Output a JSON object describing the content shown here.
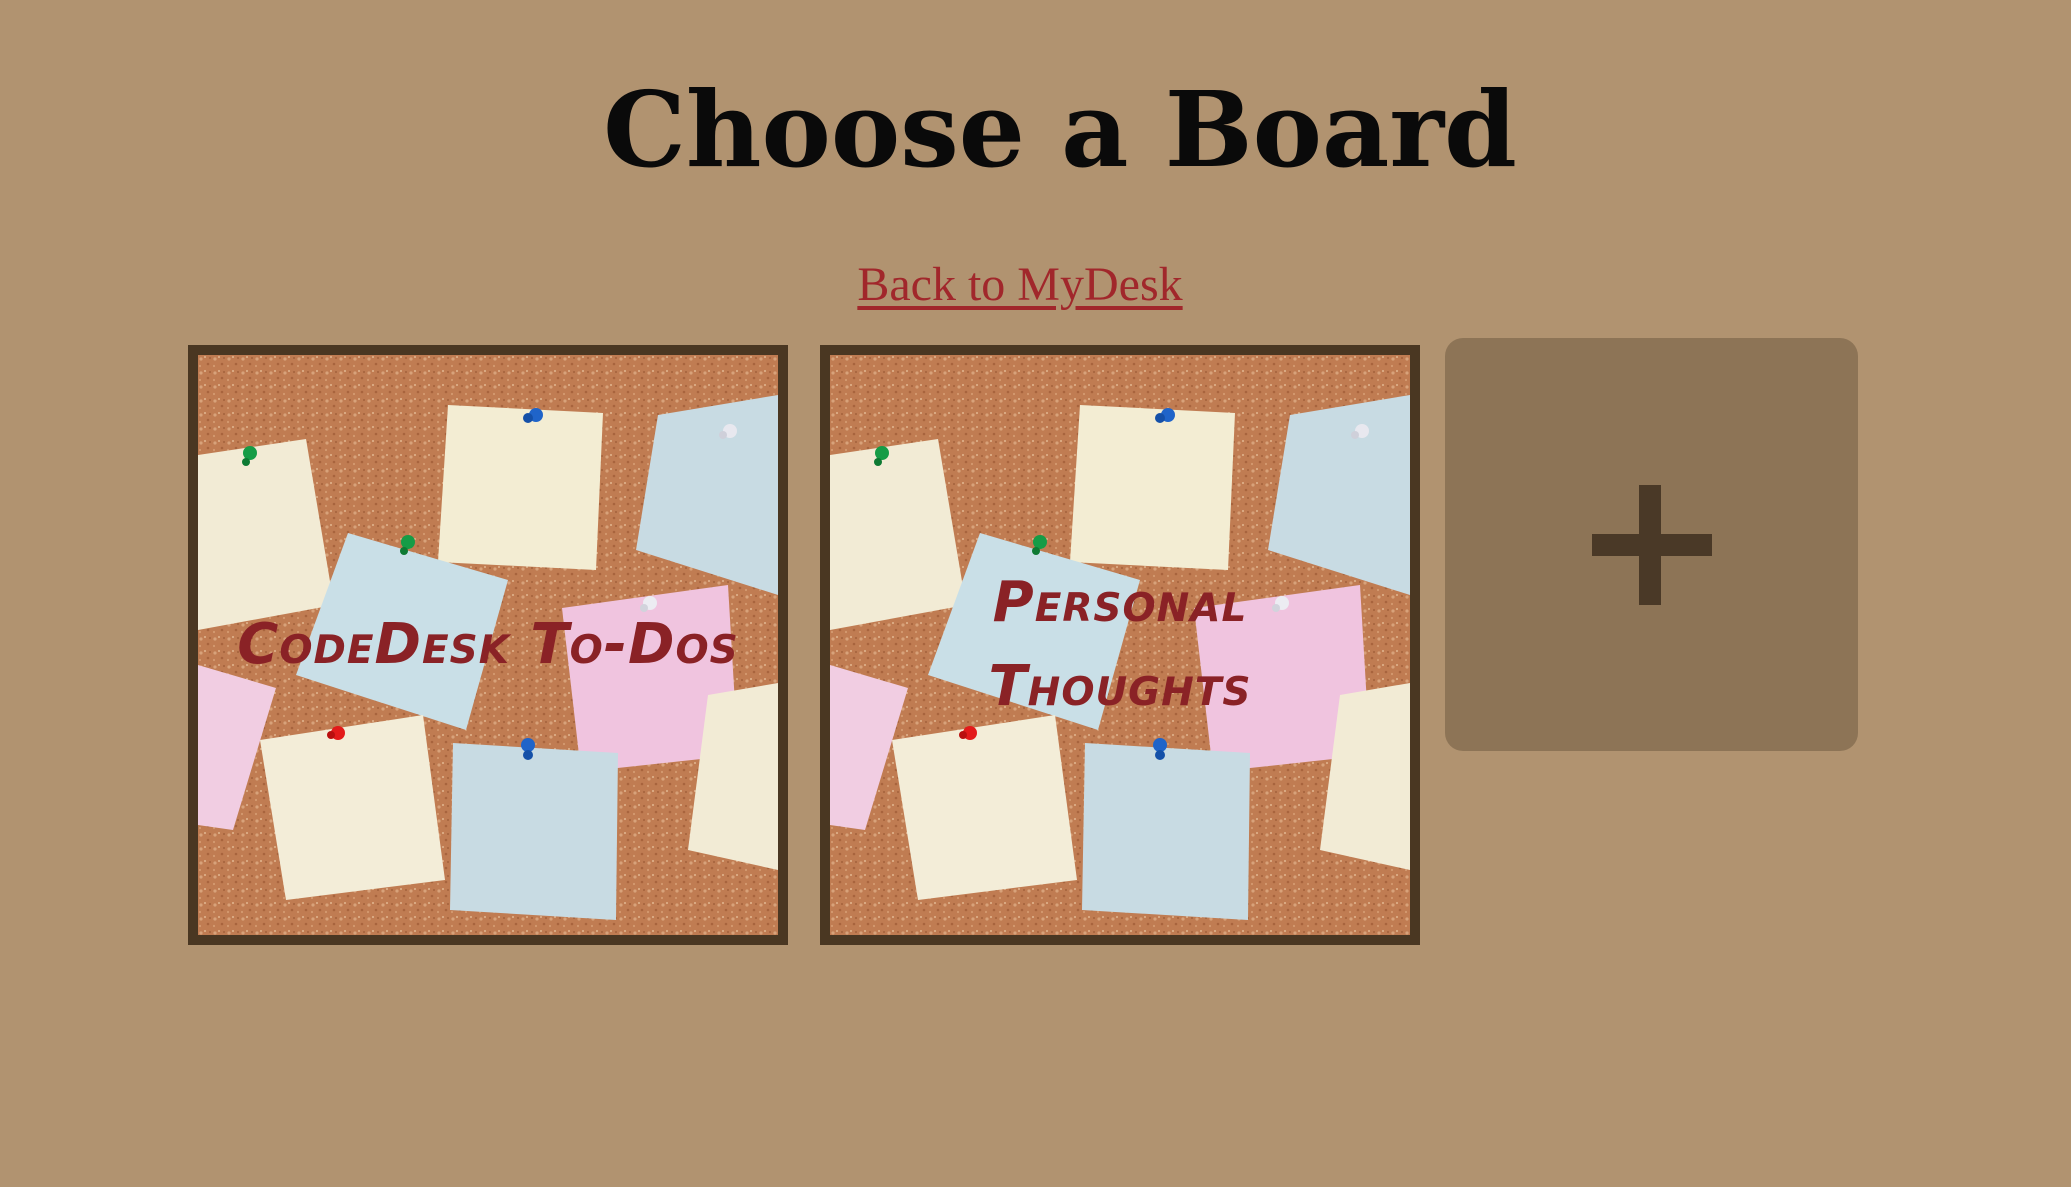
{
  "page": {
    "title": "Choose a Board",
    "back_link": "Back to MyDesk"
  },
  "boards": [
    {
      "label": "CodeDesk To-Dos"
    },
    {
      "label": "Personal Thoughts"
    }
  ],
  "add_board": {
    "icon": "plus-icon"
  },
  "colors": {
    "background": "#b19370",
    "link": "#a1272b",
    "board_border": "#4a3722",
    "board_label": "#8a2226",
    "add_tile": "#8d7456",
    "plus": "#4a3927"
  }
}
